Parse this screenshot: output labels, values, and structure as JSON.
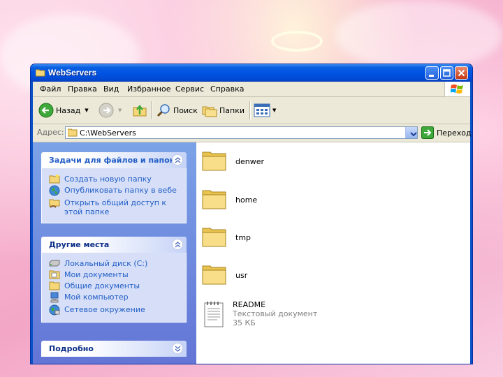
{
  "window": {
    "title": "WebServers"
  },
  "menu": [
    "Файл",
    "Правка",
    "Вид",
    "Избранное",
    "Сервис",
    "Справка"
  ],
  "toolbar": {
    "back": "Назад",
    "search": "Поиск",
    "folders": "Папки"
  },
  "address": {
    "label": "Адрес:",
    "value": "C:\\WebServers",
    "go": "Переход"
  },
  "tasks": {
    "file_tasks": {
      "title": "Задачи для файлов и папок",
      "items": [
        "Создать новую папку",
        "Опубликовать папку в вебе",
        "Открыть общий доступ к этой папке"
      ]
    },
    "other_places": {
      "title": "Другие места",
      "items": [
        "Локальный диск (C:)",
        "Мои документы",
        "Общие документы",
        "Мой компьютер",
        "Сетевое окружение"
      ]
    },
    "details": {
      "title": "Подробно"
    }
  },
  "files": [
    {
      "name": "denwer",
      "type": "folder"
    },
    {
      "name": "home",
      "type": "folder"
    },
    {
      "name": "tmp",
      "type": "folder"
    },
    {
      "name": "usr",
      "type": "folder"
    },
    {
      "name": "README",
      "type": "text-document",
      "kind": "Текстовый документ",
      "size": "35 КБ"
    }
  ],
  "colors": {
    "titlebar": "#0054e3",
    "taskpane_link": "#215dc6",
    "client": "#ece9d8"
  },
  "icons": [
    "folder-icon",
    "back-arrow-icon",
    "forward-arrow-icon",
    "up-folder-icon",
    "search-icon",
    "folders-icon",
    "views-icon",
    "go-arrow-icon",
    "windows-logo-icon"
  ]
}
